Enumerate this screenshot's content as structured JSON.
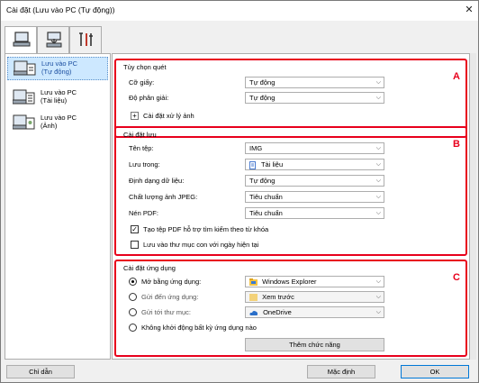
{
  "window": {
    "title": "Cài đặt (Lưu vào PC (Tự động))",
    "close_glyph": "✕"
  },
  "tabs": [
    {
      "icon": "computer-scan-icon",
      "active": true
    },
    {
      "icon": "scanner-icon",
      "active": false
    },
    {
      "icon": "tools-icon",
      "active": false
    }
  ],
  "sidebar": {
    "items": [
      {
        "line1": "Lưu vào PC",
        "line2": "(Tự động)",
        "selected": true
      },
      {
        "line1": "Lưu vào PC",
        "line2": "(Tài liệu)",
        "selected": false
      },
      {
        "line1": "Lưu vào PC",
        "line2": "(Ảnh)",
        "selected": false
      }
    ]
  },
  "scan_options": {
    "letter": "A",
    "title": "Tùy chọn quét",
    "paper_size_label": "Cỡ giấy:",
    "paper_size_value": "Tự động",
    "resolution_label": "Độ phân giải:",
    "resolution_value": "Tự động",
    "image_processing_label": "Cài đặt xử lý ảnh",
    "image_processing_toggle": "+"
  },
  "save_settings": {
    "letter": "B",
    "title": "Cài đặt lưu",
    "file_name_label": "Tên tệp:",
    "file_name_value": "IMG",
    "save_in_label": "Lưu trong:",
    "save_in_value": "Tài liệu",
    "data_format_label": "Định dạng dữ liệu:",
    "data_format_value": "Tự động",
    "jpeg_quality_label": "Chất lượng ảnh JPEG:",
    "jpeg_quality_value": "Tiêu chuẩn",
    "pdf_compression_label": "Nén PDF:",
    "pdf_compression_value": "Tiêu chuẩn",
    "create_pdf_label": "Tạo tệp PDF hỗ trợ tìm kiếm theo từ khóa",
    "create_pdf_checked": true,
    "check_glyph": "✓",
    "subfolder_label": "Lưu vào thư mục con với ngày hiện tại",
    "subfolder_checked": false
  },
  "app_settings": {
    "letter": "C",
    "title": "Cài đặt ứng dụng",
    "open_with_label": "Mở bằng ứng dụng:",
    "open_with_value": "Windows Explorer",
    "send_to_app_label": "Gửi đến ứng dụng:",
    "send_to_app_value": "Xem trước",
    "send_to_folder_label": "Gửi tới thư mục:",
    "send_to_folder_value": "OneDrive",
    "no_app_label": "Không khởi động bất kỳ ứng dụng nào",
    "add_function_label": "Thêm chức năng",
    "selected_option": "open_with"
  },
  "footer": {
    "guide_label": "Chỉ dẫn",
    "default_label": "Mặc định",
    "ok_label": "OK"
  },
  "colors": {
    "accent_red": "#e8001c",
    "selection": "#cde8ff"
  }
}
